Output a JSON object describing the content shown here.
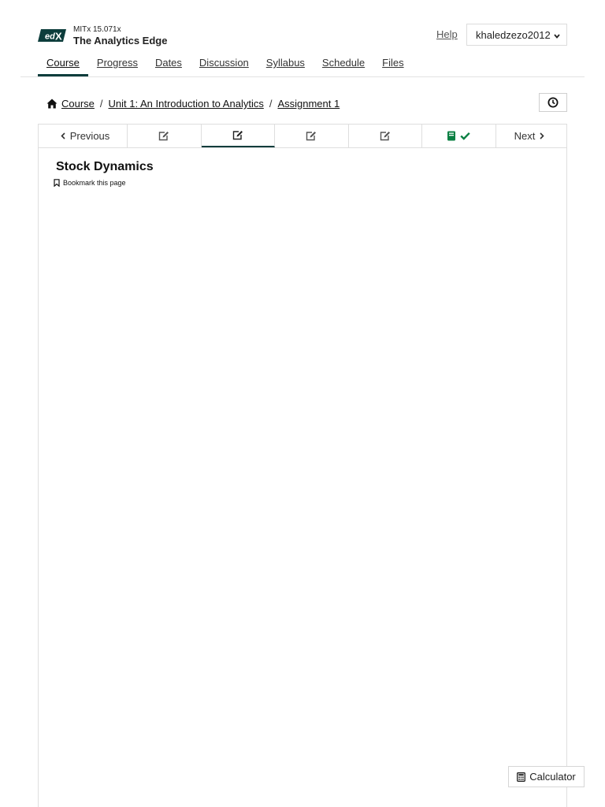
{
  "header": {
    "course_org": "MITx 15.071x",
    "course_title": "The Analytics Edge",
    "help_label": "Help",
    "username": "khaledzezo2012"
  },
  "tabs": [
    {
      "label": "Course",
      "active": true
    },
    {
      "label": "Progress"
    },
    {
      "label": "Dates"
    },
    {
      "label": "Discussion"
    },
    {
      "label": "Syllabus"
    },
    {
      "label": "Schedule"
    },
    {
      "label": "Files"
    }
  ],
  "breadcrumb": {
    "items": [
      "Course",
      "Unit 1: An Introduction to Analytics",
      "Assignment 1"
    ],
    "separator": "/"
  },
  "sequence": {
    "previous_label": "Previous",
    "next_label": "Next",
    "units": [
      {
        "icon": "edit-icon"
      },
      {
        "icon": "edit-icon",
        "active": true
      },
      {
        "icon": "edit-icon"
      },
      {
        "icon": "edit-icon"
      },
      {
        "icon": "book-icon",
        "completed": true
      }
    ]
  },
  "unit": {
    "title": "Stock Dynamics",
    "bookmark_label": "Bookmark this page"
  },
  "calculator_label": "Calculator",
  "colors": {
    "brand_dark": "#0d3d3c",
    "completed_green": "#0b8043",
    "border": "#dedede"
  }
}
